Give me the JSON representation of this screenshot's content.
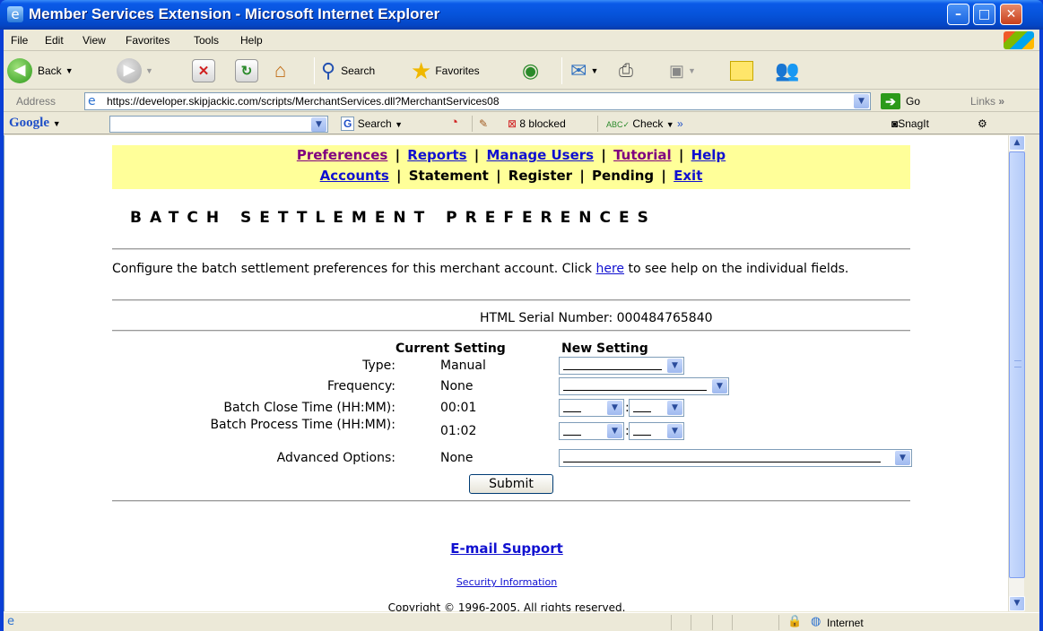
{
  "window": {
    "title": "Member Services Extension - Microsoft Internet Explorer",
    "min_glyph": "–",
    "max_glyph": "□",
    "close_glyph": "✕"
  },
  "menu": [
    "File",
    "Edit",
    "View",
    "Favorites",
    "Tools",
    "Help"
  ],
  "toolbar": {
    "back_label": "Back",
    "search_label": "Search",
    "favorites_label": "Favorites"
  },
  "address": {
    "label": "Address",
    "url": "https://developer.skipjackic.com/scripts/MerchantServices.dll?MerchantServices08",
    "go_label": "Go",
    "links_label": "Links"
  },
  "googlebar": {
    "logo": "Google",
    "search_label": "Search",
    "blocked_label": "8 blocked",
    "check_label": "Check",
    "snagit_label": "SnagIt"
  },
  "nav": {
    "row1": [
      {
        "label": "Preferences",
        "visited": true
      },
      {
        "label": "Reports",
        "visited": false
      },
      {
        "label": "Manage Users",
        "visited": false
      },
      {
        "label": "Tutorial",
        "visited": true
      },
      {
        "label": "Help",
        "visited": false
      }
    ],
    "row2": [
      {
        "label": "Accounts",
        "link": true
      },
      {
        "label": "Statement",
        "link": false
      },
      {
        "label": "Register",
        "link": false
      },
      {
        "label": "Pending",
        "link": false
      },
      {
        "label": "Exit",
        "link": true
      }
    ],
    "separator": "|"
  },
  "page": {
    "title": "BATCH SETTLEMENT PREFERENCES",
    "description_before": "Configure the batch settlement preferences for this merchant account.  Click ",
    "description_link": "here",
    "description_after": " to see help on the individual fields.",
    "serial": "HTML Serial Number: 000484765840"
  },
  "form": {
    "header_current": "Current Setting",
    "header_new": "New Setting",
    "fields": [
      {
        "label": "Type:",
        "current": "Manual"
      },
      {
        "label": "Frequency:",
        "current": "None"
      },
      {
        "label": "Batch Close Time (HH:MM):",
        "current": "00:01"
      },
      {
        "label": "Batch Process Time (HH:MM):",
        "current": "01:02"
      },
      {
        "label": "Advanced Options:",
        "current": "None"
      }
    ],
    "submit_label": "Submit"
  },
  "footer": {
    "support_link": "E-mail Support",
    "security_link": "Security Information",
    "copyright": "Copyright © 1996-2005. All rights reserved."
  },
  "status": {
    "zone": "Internet"
  },
  "colors": {
    "nav_background": "#ffff99",
    "link": "#1010d0",
    "visited_link": "#800080",
    "titlebar": "#0653da"
  }
}
